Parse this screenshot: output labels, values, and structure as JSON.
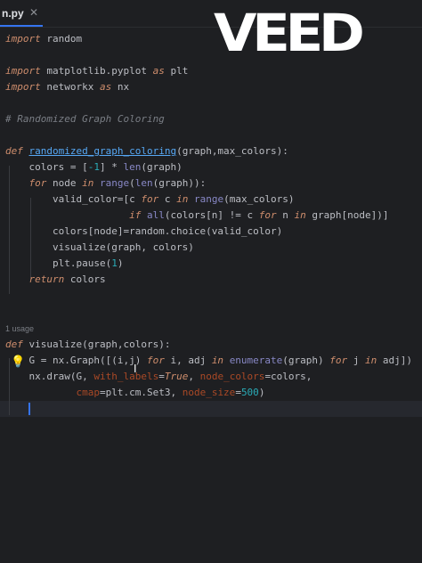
{
  "tab": {
    "filename": "n.py",
    "close": "✕"
  },
  "watermark": {
    "text": "VEED"
  },
  "editor": {
    "usage_hint": "1 usage",
    "lines": [
      {
        "id": "l1",
        "tokens": [
          [
            "kw",
            "import"
          ],
          [
            "plain",
            " random"
          ]
        ]
      },
      {
        "id": "l3",
        "tokens": [
          [
            "kw",
            "import"
          ],
          [
            "plain",
            " matplotlib.pyplot "
          ],
          [
            "kw",
            "as"
          ],
          [
            "plain",
            " plt"
          ]
        ]
      },
      {
        "id": "l4",
        "tokens": [
          [
            "kw",
            "import"
          ],
          [
            "plain",
            " networkx "
          ],
          [
            "kw",
            "as"
          ],
          [
            "plain",
            " nx"
          ]
        ]
      },
      {
        "id": "l6",
        "tokens": [
          [
            "cm",
            "# Randomized Graph Coloring"
          ]
        ]
      },
      {
        "id": "l8",
        "tokens": [
          [
            "kw",
            "def"
          ],
          [
            "plain",
            " "
          ],
          [
            "fn",
            "randomized_graph_coloring"
          ],
          [
            "plain",
            "(graph,max_colors):"
          ]
        ]
      },
      {
        "id": "l9",
        "tokens": [
          [
            "plain",
            "    colors = ["
          ],
          [
            "num",
            "-1"
          ],
          [
            "plain",
            "] * "
          ],
          [
            "bi",
            "len"
          ],
          [
            "plain",
            "(graph)"
          ]
        ]
      },
      {
        "id": "l10",
        "tokens": [
          [
            "plain",
            "    "
          ],
          [
            "kw",
            "for"
          ],
          [
            "plain",
            " node "
          ],
          [
            "kw",
            "in"
          ],
          [
            "plain",
            " "
          ],
          [
            "bi",
            "range"
          ],
          [
            "plain",
            "("
          ],
          [
            "bi",
            "len"
          ],
          [
            "plain",
            "(graph)):"
          ]
        ]
      },
      {
        "id": "l11",
        "tokens": [
          [
            "plain",
            "        valid_color=[c "
          ],
          [
            "kw",
            "for"
          ],
          [
            "plain",
            " c "
          ],
          [
            "kw",
            "in"
          ],
          [
            "plain",
            " "
          ],
          [
            "bi",
            "range"
          ],
          [
            "plain",
            "(max_colors)"
          ]
        ]
      },
      {
        "id": "l12",
        "tokens": [
          [
            "plain",
            "                     "
          ],
          [
            "kw",
            "if"
          ],
          [
            "plain",
            " "
          ],
          [
            "bi",
            "all"
          ],
          [
            "plain",
            "(colors[n] != c "
          ],
          [
            "kw",
            "for"
          ],
          [
            "plain",
            " n "
          ],
          [
            "kw",
            "in"
          ],
          [
            "plain",
            " graph[node])]"
          ]
        ]
      },
      {
        "id": "l13",
        "tokens": [
          [
            "plain",
            "        colors[node]=random.choice(valid_color)"
          ]
        ]
      },
      {
        "id": "l14",
        "tokens": [
          [
            "plain",
            "        visualize(graph, colors)"
          ]
        ]
      },
      {
        "id": "l15",
        "tokens": [
          [
            "plain",
            "        plt.pause("
          ],
          [
            "num",
            "1"
          ],
          [
            "plain",
            ")"
          ]
        ]
      },
      {
        "id": "l16",
        "tokens": [
          [
            "plain",
            "    "
          ],
          [
            "kw",
            "return"
          ],
          [
            "plain",
            " colors"
          ]
        ]
      },
      {
        "id": "l19",
        "tokens": [
          [
            "kw",
            "def"
          ],
          [
            "plain",
            " visualize(graph,colors):"
          ]
        ]
      },
      {
        "id": "l20",
        "tokens": [
          [
            "plain",
            "    G = nx.Graph([(i,j) "
          ],
          [
            "kw",
            "for"
          ],
          [
            "plain",
            " i, adj "
          ],
          [
            "kw",
            "in"
          ],
          [
            "plain",
            " "
          ],
          [
            "bi",
            "enumerate"
          ],
          [
            "plain",
            "(graph) "
          ],
          [
            "kw",
            "for"
          ],
          [
            "plain",
            " j "
          ],
          [
            "kw",
            "in"
          ],
          [
            "plain",
            " adj])"
          ]
        ]
      },
      {
        "id": "l21",
        "tokens": [
          [
            "plain",
            "    nx.draw(G, "
          ],
          [
            "nm",
            "with_labels"
          ],
          [
            "plain",
            "="
          ],
          [
            "kw",
            "True"
          ],
          [
            "plain",
            ", "
          ],
          [
            "nm",
            "node_colors"
          ],
          [
            "plain",
            "=colors,"
          ]
        ]
      },
      {
        "id": "l22",
        "tokens": [
          [
            "plain",
            "            "
          ],
          [
            "nm",
            "cmap"
          ],
          [
            "plain",
            "=plt.cm.Set3, "
          ],
          [
            "nm",
            "node_size"
          ],
          [
            "plain",
            "="
          ],
          [
            "num",
            "500"
          ],
          [
            "plain",
            ")"
          ]
        ]
      }
    ]
  }
}
